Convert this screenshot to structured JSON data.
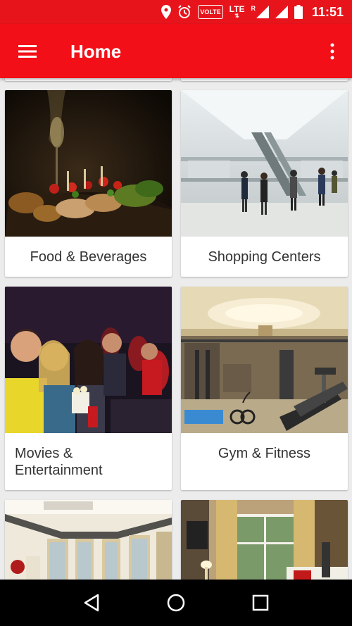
{
  "status_bar": {
    "time": "11:51",
    "volte": "VOLTE",
    "lte": "LTE",
    "roaming": "R",
    "icons": [
      "location-icon",
      "alarm-icon",
      "volte-icon",
      "lte-icon",
      "signal-icon",
      "signal-icon",
      "battery-icon"
    ]
  },
  "app_bar": {
    "title": "Home",
    "background": "#f20f17",
    "icons": [
      "menu-icon",
      "more-vert-icon"
    ]
  },
  "categories": [
    {
      "label": "Food & Beverages"
    },
    {
      "label": "Shopping Centers"
    },
    {
      "label": "Movies & Entertainment"
    },
    {
      "label": "Gym & Fitness"
    }
  ],
  "nav_bar": {
    "icons": [
      "back-icon",
      "home-icon",
      "recents-icon"
    ]
  }
}
